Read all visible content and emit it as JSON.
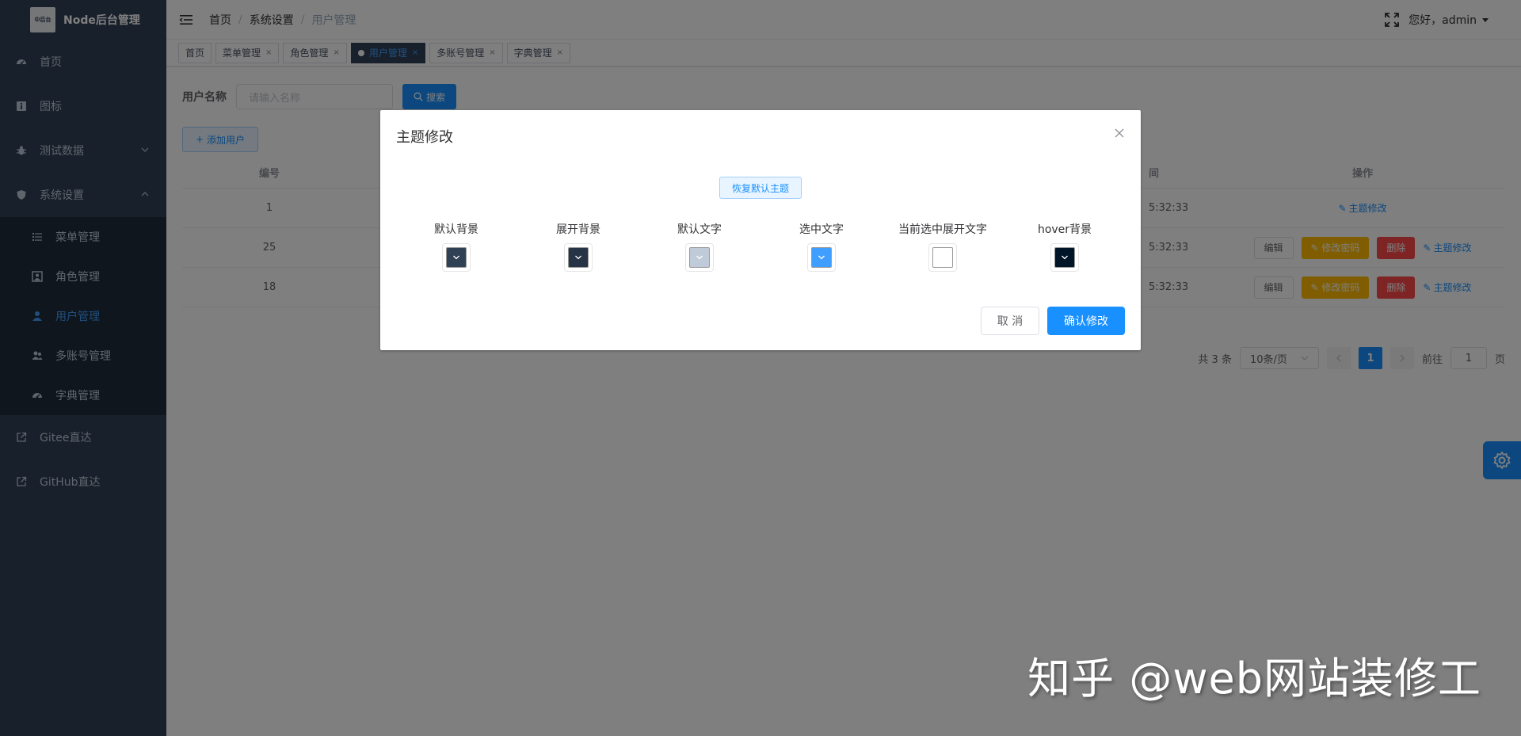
{
  "sidebar": {
    "logo_text": "中后台",
    "title": "Node后台管理",
    "items": [
      {
        "label": "首页",
        "icon": "dashboard-icon"
      },
      {
        "label": "图标",
        "icon": "info-icon"
      },
      {
        "label": "测试数据",
        "icon": "bug-icon"
      },
      {
        "label": "系统设置",
        "icon": "shield-icon"
      }
    ],
    "sub_items": [
      {
        "label": "菜单管理",
        "icon": "list-icon"
      },
      {
        "label": "角色管理",
        "icon": "role-icon"
      },
      {
        "label": "用户管理",
        "icon": "user-icon"
      },
      {
        "label": "多账号管理",
        "icon": "users-icon"
      },
      {
        "label": "字典管理",
        "icon": "dict-icon"
      }
    ],
    "links": [
      {
        "label": "Gitee直达",
        "icon": "external-link-icon"
      },
      {
        "label": "GitHub直达",
        "icon": "external-link-icon"
      }
    ],
    "colors": {
      "bg": "#304156",
      "active": "#409eff"
    }
  },
  "navbar": {
    "breadcrumb": [
      "首页",
      "系统设置",
      "用户管理"
    ],
    "greeting": "您好，admin"
  },
  "tags": [
    {
      "label": "首页",
      "closable": false,
      "active": false
    },
    {
      "label": "菜单管理",
      "closable": true,
      "active": false
    },
    {
      "label": "角色管理",
      "closable": true,
      "active": false
    },
    {
      "label": "用户管理",
      "closable": true,
      "active": true
    },
    {
      "label": "多账号管理",
      "closable": true,
      "active": false
    },
    {
      "label": "字典管理",
      "closable": true,
      "active": false
    }
  ],
  "search": {
    "label": "用户名称",
    "placeholder": "请输入名称",
    "button": "搜索"
  },
  "add_button": "添加用户",
  "table": {
    "headers": {
      "id": "编号",
      "time": "间",
      "ops": "操作"
    },
    "rows": [
      {
        "id": "1",
        "time": "5:32:33",
        "ops": [
          "主题修改"
        ]
      },
      {
        "id": "25",
        "time": "5:32:33",
        "ops": [
          "编辑",
          "修改密码",
          "删除",
          "主题修改"
        ]
      },
      {
        "id": "18",
        "time": "5:32:33",
        "ops": [
          "编辑",
          "修改密码",
          "删除",
          "主题修改"
        ]
      }
    ]
  },
  "pagination": {
    "total": "共 3 条",
    "page_size": "10条/页",
    "current_page": "1",
    "goto_label": "前往",
    "goto_value": "1",
    "page_suffix": "页"
  },
  "dialog": {
    "title": "主题修改",
    "reset_button": "恢复默认主题",
    "pickers": [
      {
        "label": "默认背景",
        "color": "#304156"
      },
      {
        "label": "展开背景",
        "color": "#263445"
      },
      {
        "label": "默认文字",
        "color": "#bfcbd9"
      },
      {
        "label": "选中文字",
        "color": "#409eff"
      },
      {
        "label": "当前选中展开文字",
        "color": "#ffffff"
      },
      {
        "label": "hover背景",
        "color": "#001528"
      }
    ],
    "cancel": "取 消",
    "confirm": "确认修改"
  },
  "watermark": "知乎 @web网站装修工"
}
